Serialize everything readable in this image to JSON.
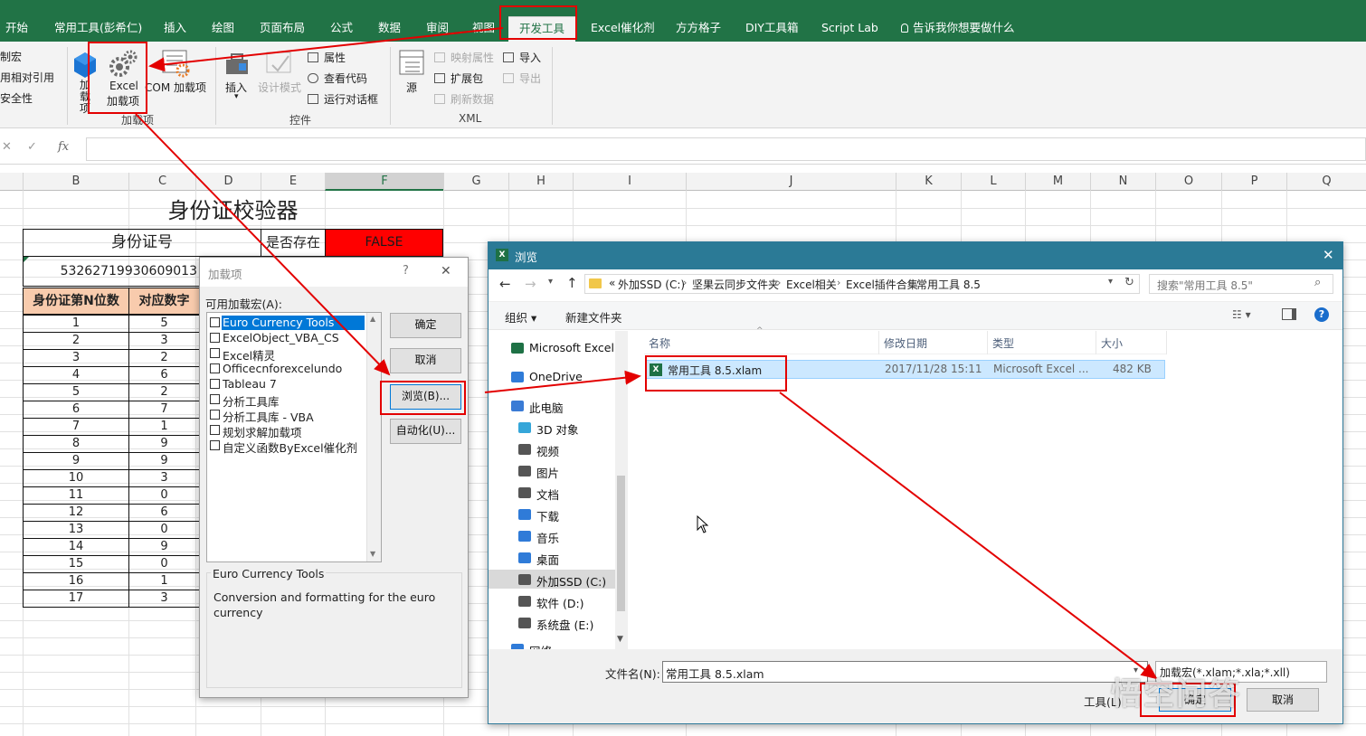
{
  "ribbon": {
    "tabs": [
      "开始",
      "常用工具(彭希仁)",
      "插入",
      "绘图",
      "页面布局",
      "公式",
      "数据",
      "审阅",
      "视图",
      "开发工具",
      "Excel催化剂",
      "方方格子",
      "DIY工具箱",
      "Script Lab",
      "告诉我你想要做什么"
    ],
    "code_items": [
      "制宏",
      "用相对引用",
      "安全性"
    ],
    "addin_buttons": {
      "addin": "加载项",
      "excel_addin_1": "Excel",
      "excel_addin_2": "加载项",
      "com_addin": "COM 加载项"
    },
    "controls": {
      "insert": "插入",
      "design_mode": "设计模式",
      "properties": "属性",
      "view_code": "查看代码",
      "run_dialog": "运行对话框"
    },
    "xml": {
      "source": "源",
      "map_props": "映射属性",
      "expansion": "扩展包",
      "refresh": "刷新数据",
      "import": "导入",
      "export": "导出"
    },
    "group_labels": {
      "addins": "加载项",
      "controls": "控件",
      "xml": "XML"
    }
  },
  "formula_bar": {
    "fx": "fx"
  },
  "columns": [
    "B",
    "C",
    "D",
    "E",
    "F",
    "G",
    "H",
    "I",
    "J",
    "K",
    "L",
    "M",
    "N",
    "O",
    "P",
    "Q"
  ],
  "sheet": {
    "title": "身份证校验器",
    "id_label": "身份证号",
    "exists_label": "是否存在",
    "exists_value": "FALSE",
    "id_value": "53262719930609013",
    "table_headers": [
      "身份证第N位数",
      "对应数字"
    ],
    "rows": [
      [
        "1",
        "5"
      ],
      [
        "2",
        "3"
      ],
      [
        "3",
        "2"
      ],
      [
        "4",
        "6"
      ],
      [
        "5",
        "2"
      ],
      [
        "6",
        "7"
      ],
      [
        "7",
        "1"
      ],
      [
        "8",
        "9"
      ],
      [
        "9",
        "9"
      ],
      [
        "10",
        "3"
      ],
      [
        "11",
        "0"
      ],
      [
        "12",
        "6"
      ],
      [
        "13",
        "0"
      ],
      [
        "14",
        "9"
      ],
      [
        "15",
        "0"
      ],
      [
        "16",
        "1"
      ],
      [
        "17",
        "3"
      ]
    ]
  },
  "addins_dialog": {
    "title": "加载项",
    "help": "?",
    "close": "✕",
    "list_label": "可用加载宏(A):",
    "items": [
      "Euro Currency Tools",
      "ExcelObject_VBA_CS",
      "Excel精灵",
      "Officecnforexcelundo",
      "Tableau 7",
      "分析工具库",
      "分析工具库 - VBA",
      "规划求解加载项",
      "自定义函数ByExcel催化剂"
    ],
    "ok": "确定",
    "cancel": "取消",
    "browse": "浏览(B)...",
    "automation": "自动化(U)...",
    "desc_title": "Euro Currency Tools",
    "desc_text": "Conversion and formatting for the euro currency"
  },
  "browse_dialog": {
    "title": "浏览",
    "close": "✕",
    "breadcrumb": [
      "«",
      "外加SSD (C:)",
      "坚果云同步文件夹",
      "Excel相关",
      "Excel插件合集",
      "常用工具 8.5"
    ],
    "search_placeholder": "搜索\"常用工具 8.5\"",
    "organize": "组织 ▾",
    "new_folder": "新建文件夹",
    "nav": [
      "Microsoft Excel",
      "OneDrive",
      "此电脑",
      "3D 对象",
      "视频",
      "图片",
      "文档",
      "下载",
      "音乐",
      "桌面",
      "外加SSD (C:)",
      "软件 (D:)",
      "系统盘 (E:)",
      "网络"
    ],
    "col_headers": [
      "名称",
      "修改日期",
      "类型",
      "大小"
    ],
    "file": {
      "name": "常用工具 8.5.xlam",
      "date": "2017/11/28 15:11",
      "type": "Microsoft Excel ...",
      "size": "482 KB"
    },
    "filename_label": "文件名(N):",
    "filename_value": "常用工具 8.5.xlam",
    "filter_value": "加载宏(*.xlam;*.xla;*.xll)",
    "tools": "工具(L)",
    "ok": "确定",
    "cancel": "取消"
  },
  "watermark": "悟空问答",
  "colors": {
    "excel_green": "#217346",
    "false_red": "#ff0000",
    "header_peach": "#f8cbad",
    "annotation_red": "#e30000",
    "selection_blue": "#cce8ff"
  }
}
